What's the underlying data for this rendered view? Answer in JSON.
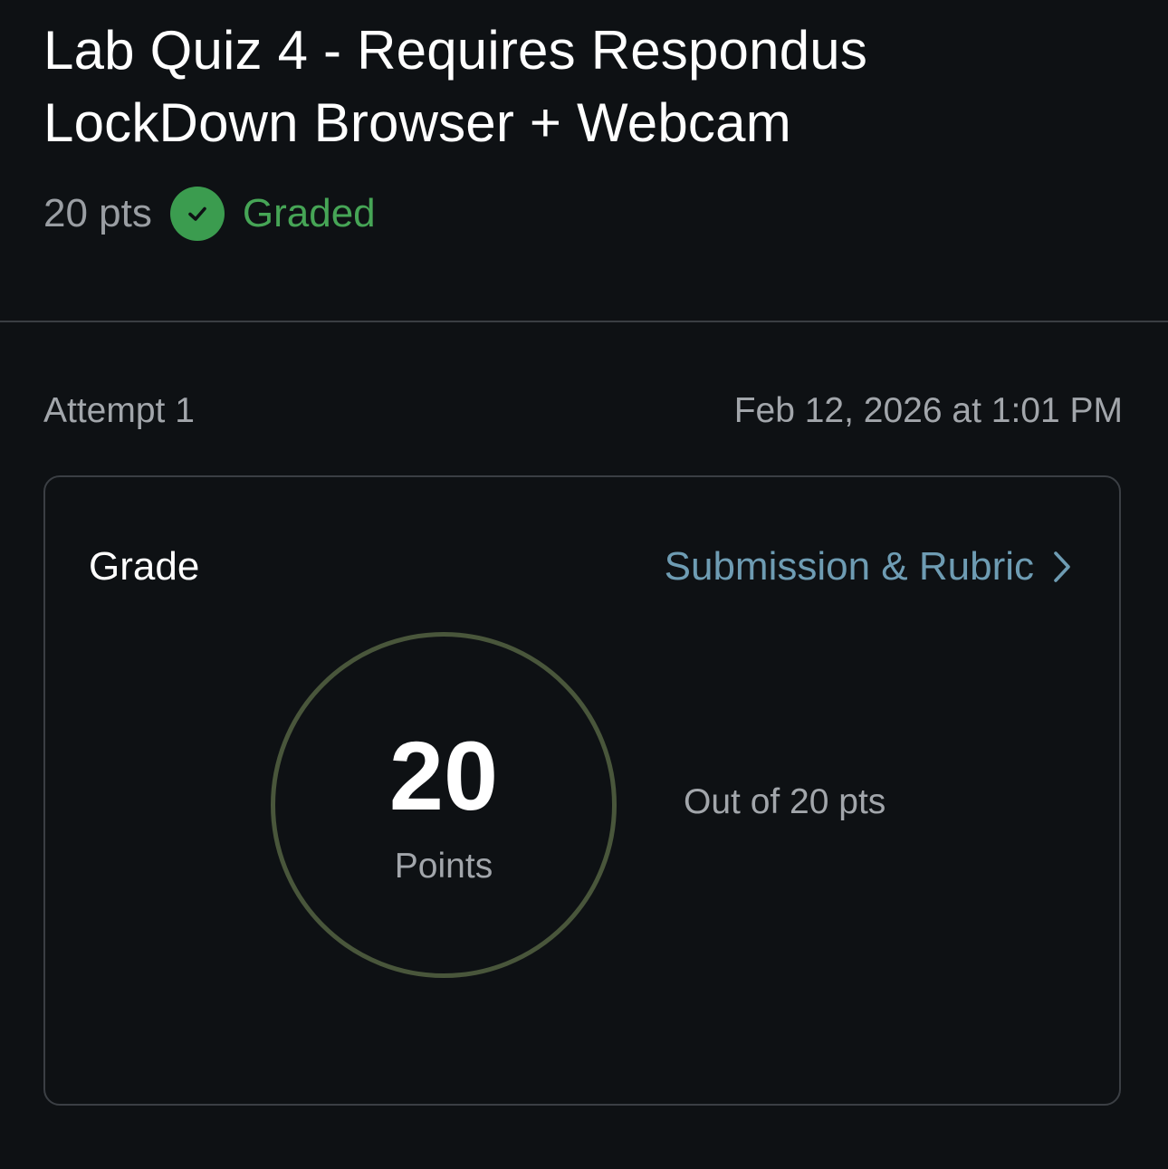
{
  "assignment": {
    "title": "Lab Quiz 4 - Requires Respondus LockDown Browser + Webcam",
    "points": "20 pts",
    "status": "Graded",
    "status_icon": "check-circle-icon",
    "status_color": "#3b9c4f"
  },
  "attempt": {
    "label": "Attempt 1",
    "submitted_at": "Feb 12, 2026 at 1:01 PM"
  },
  "grade_card": {
    "label": "Grade",
    "link_label": "Submission & Rubric",
    "link_icon": "chevron-right-icon",
    "score": "20",
    "score_unit": "Points",
    "out_of": "Out of 20 pts",
    "ring_color": "#49563b",
    "link_color": "#6e9cb3"
  }
}
